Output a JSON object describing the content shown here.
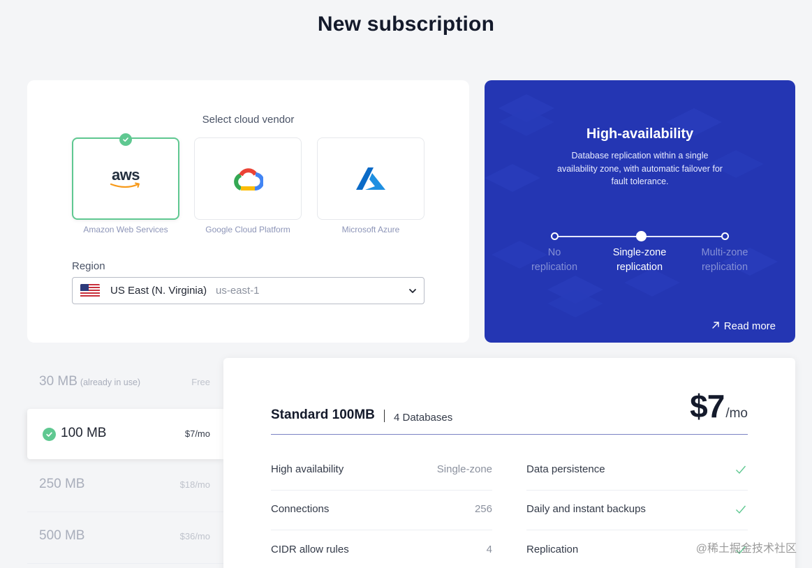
{
  "page": {
    "title": "New subscription"
  },
  "vendor": {
    "heading": "Select cloud vendor",
    "options": [
      {
        "label": "Amazon Web Services",
        "logo_text": "aws",
        "selected": true
      },
      {
        "label": "Google Cloud Platform",
        "selected": false
      },
      {
        "label": "Microsoft Azure",
        "selected": false
      }
    ]
  },
  "region": {
    "label": "Region",
    "value": "US East (N. Virginia)",
    "code": "us-east-1"
  },
  "availability": {
    "title": "High-availability",
    "description": "Database replication within a single availability zone, with automatic failover for fault tolerance.",
    "options": [
      {
        "line1": "No",
        "line2": "replication"
      },
      {
        "line1": "Single-zone",
        "line2": "replication"
      },
      {
        "line1": "Multi-zone",
        "line2": "replication"
      }
    ],
    "selected_index": 1,
    "read_more": "Read more"
  },
  "plans": [
    {
      "size": "30 MB",
      "note": "(already in use)",
      "price": "Free"
    },
    {
      "size": "100 MB",
      "price": "$7/mo",
      "selected": true
    },
    {
      "size": "250 MB",
      "price": "$18/mo"
    },
    {
      "size": "500 MB",
      "price": "$36/mo"
    }
  ],
  "detail": {
    "name": "Standard 100MB",
    "databases": "4 Databases",
    "price": "$7",
    "per": "/mo",
    "left_features": [
      {
        "name": "High availability",
        "value": "Single-zone"
      },
      {
        "name": "Connections",
        "value": "256"
      },
      {
        "name": "CIDR allow rules",
        "value": "4"
      }
    ],
    "right_features": [
      {
        "name": "Data persistence",
        "included": true
      },
      {
        "name": "Daily and instant backups",
        "included": true
      },
      {
        "name": "Replication",
        "included": true
      }
    ]
  },
  "watermark": "@稀土掘金技术社区",
  "colors": {
    "accent_green": "#5fc891",
    "ha_blue": "#2436b3"
  }
}
